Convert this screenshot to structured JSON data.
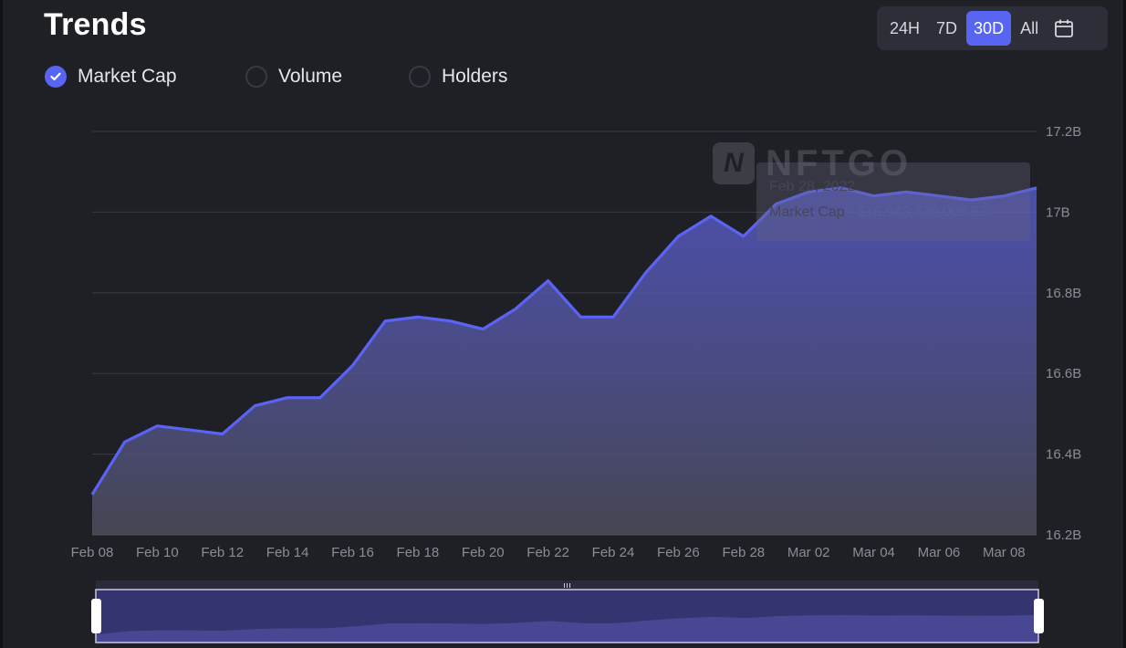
{
  "header": {
    "title": "Trends"
  },
  "range": {
    "options": [
      "24H",
      "7D",
      "30D",
      "All"
    ],
    "selected": "30D",
    "calendar_icon": "calendar-icon"
  },
  "metrics": [
    {
      "label": "Market Cap",
      "checked": true
    },
    {
      "label": "Volume",
      "checked": false
    },
    {
      "label": "Holders",
      "checked": false
    }
  ],
  "watermark": {
    "text": "NFTGO"
  },
  "tooltip": {
    "date": "Feb 28, 2022",
    "label": "Market Cap",
    "value": "$16,943,430,009.53"
  },
  "colors": {
    "accent": "#5865f2",
    "line": "#5b63f5",
    "background": "#1f1f26"
  },
  "chart_data": {
    "type": "area",
    "x": [
      "Feb 08",
      "Feb 09",
      "Feb 10",
      "Feb 11",
      "Feb 12",
      "Feb 13",
      "Feb 14",
      "Feb 15",
      "Feb 16",
      "Feb 17",
      "Feb 18",
      "Feb 19",
      "Feb 20",
      "Feb 21",
      "Feb 22",
      "Feb 23",
      "Feb 24",
      "Feb 25",
      "Feb 26",
      "Feb 27",
      "Feb 28",
      "Mar 01",
      "Mar 02",
      "Mar 03",
      "Mar 04",
      "Mar 05",
      "Mar 06",
      "Mar 07",
      "Mar 08",
      "Mar 09"
    ],
    "x_tick_labels": [
      "Feb 08",
      "Feb 10",
      "Feb 12",
      "Feb 14",
      "Feb 16",
      "Feb 18",
      "Feb 20",
      "Feb 22",
      "Feb 24",
      "Feb 26",
      "Feb 28",
      "Mar 02",
      "Mar 04",
      "Mar 06",
      "Mar 08"
    ],
    "series": [
      {
        "values": [
          16.3,
          16.43,
          16.47,
          16.46,
          16.45,
          16.52,
          16.54,
          16.54,
          16.62,
          16.73,
          16.74,
          16.73,
          16.71,
          16.76,
          16.83,
          16.74,
          16.74,
          16.85,
          16.94,
          16.99,
          16.94,
          17.02,
          17.05,
          17.06,
          17.04,
          17.05,
          17.04,
          17.03,
          17.04,
          17.06
        ]
      }
    ],
    "y_tick_labels": [
      "16.2B",
      "16.4B",
      "16.6B",
      "16.8B",
      "17B",
      "17.2B"
    ],
    "ylim": [
      16.2,
      17.2
    ],
    "y_unit": "B",
    "grid": true,
    "y_axis_position": "right"
  }
}
